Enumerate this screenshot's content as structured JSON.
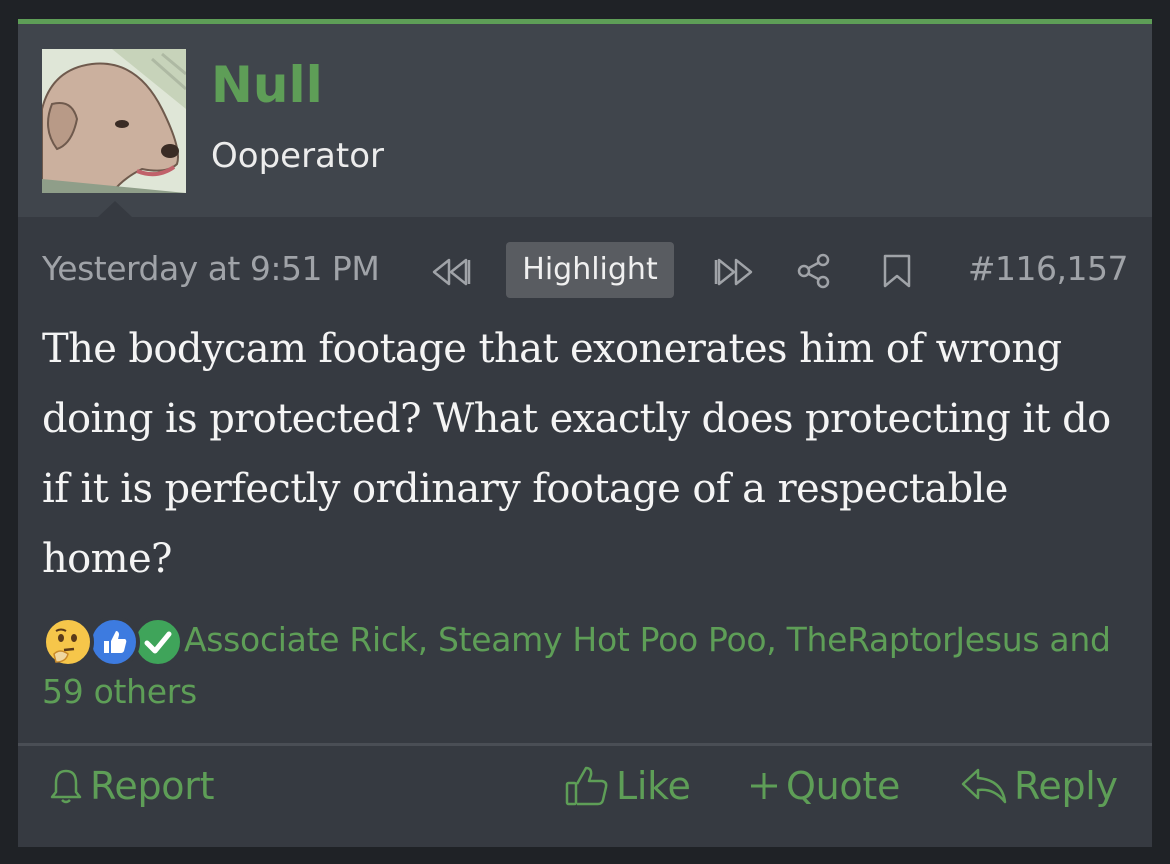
{
  "post": {
    "username": "Null",
    "user_title": "Ooperator",
    "timestamp": "Yesterday at 9:51 PM",
    "highlight_label": "Highlight",
    "post_number": "#116,157",
    "body": "The bodycam footage that exonerates him of wrong doing is protected? What exactly does protecting it do if it is perfectly ordinary footage of a respectable home?",
    "reactions_text": "Associate Rick, Steamy Hot Poo Poo, TheRaptorJesus and 59 others",
    "reaction_icons": [
      "thinking-face-icon",
      "thumbs-up-icon",
      "check-icon"
    ]
  },
  "footer": {
    "report_label": "Report",
    "like_label": "Like",
    "quote_label": "Quote",
    "reply_label": "Reply"
  },
  "colors": {
    "accent": "#5e9e57",
    "background": "#363a41",
    "header": "#40454c",
    "muted_text": "#a0a3a8"
  }
}
